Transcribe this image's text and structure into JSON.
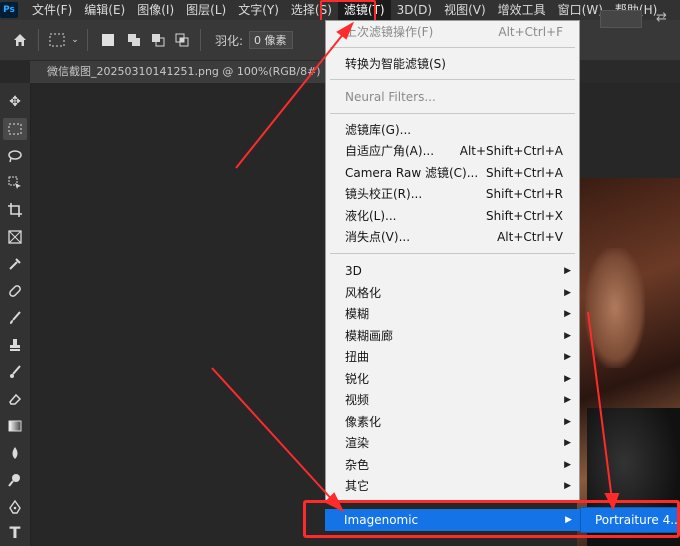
{
  "menubar": {
    "logo": "Ps",
    "items": [
      "文件(F)",
      "编辑(E)",
      "图像(I)",
      "图层(L)",
      "文字(Y)",
      "选择(S)",
      "滤镜(T)",
      "3D(D)",
      "视图(V)",
      "增效工具",
      "窗口(W)",
      "帮助(H)"
    ],
    "active": "滤镜(T)"
  },
  "options": {
    "feather_label": "羽化:",
    "feather_value": "0 像素"
  },
  "document_tab": {
    "title": "微信截图_20250310141251.png @ 100%(RGB/8#)"
  },
  "filter_menu": {
    "last_filter": {
      "label": "上次滤镜操作(F)",
      "shortcut": "Alt+Ctrl+F"
    },
    "convert_smart": {
      "label": "转换为智能滤镜(S)"
    },
    "neural": {
      "label": "Neural Filters..."
    },
    "group_items": [
      {
        "label": "滤镜库(G)...",
        "shortcut": ""
      },
      {
        "label": "自适应广角(A)...",
        "shortcut": "Alt+Shift+Ctrl+A"
      },
      {
        "label": "Camera Raw 滤镜(C)...",
        "shortcut": "Shift+Ctrl+A"
      },
      {
        "label": "镜头校正(R)...",
        "shortcut": "Shift+Ctrl+R"
      },
      {
        "label": "液化(L)...",
        "shortcut": "Shift+Ctrl+X"
      },
      {
        "label": "消失点(V)...",
        "shortcut": "Alt+Ctrl+V"
      }
    ],
    "submenus": [
      "3D",
      "风格化",
      "模糊",
      "模糊画廊",
      "扭曲",
      "锐化",
      "视频",
      "像素化",
      "渲染",
      "杂色",
      "其它"
    ],
    "highlighted": "Imagenomic",
    "plugin_item": "Portraiture 4..."
  },
  "icons": {
    "home": "home-icon",
    "marquee": "marquee-icon",
    "arrange": "arrange-icon"
  },
  "colors": {
    "highlight": "#1473e6",
    "annotation": "#ff2b2b"
  }
}
